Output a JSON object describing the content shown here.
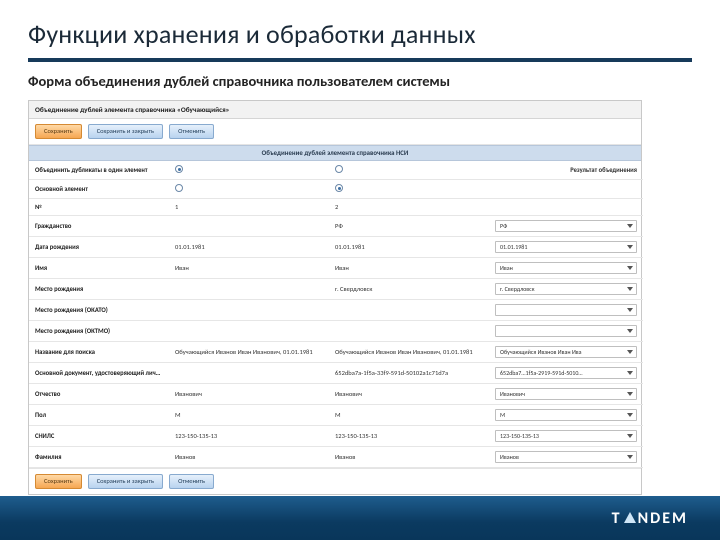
{
  "slide": {
    "title": "Функции хранения и обработки данных",
    "subtitle": "Форма объединения дублей справочника пользователем системы"
  },
  "app": {
    "header": "Объединение дублей элемента справочника «Обучающийся»",
    "band": "Объединение дублей элемента справочника НСИ",
    "buttons": {
      "save": "Сохранить",
      "save_close": "Сохранить и закрыть",
      "cancel": "Отменить"
    },
    "columns": {
      "result_header": "Результат объединения"
    },
    "rows": [
      {
        "label": "Объединить дубликаты в один элемент",
        "c1_radio": true,
        "c2_radio": false,
        "result": null
      },
      {
        "label": "Основной элемент",
        "c1_radio": false,
        "c2_radio": true,
        "result": null
      },
      {
        "label": "№",
        "c1": "1",
        "c2": "2",
        "result": null
      },
      {
        "label": "Гражданство",
        "c1": "",
        "c2": "РФ",
        "result": "РФ"
      },
      {
        "label": "Дата рождения",
        "c1": "01.01.1981",
        "c2": "01.01.1981",
        "result": "01.01.1981"
      },
      {
        "label": "Имя",
        "c1": "Иван",
        "c2": "Иван",
        "result": "Иван"
      },
      {
        "label": "Место рождения",
        "c1": "",
        "c2": "г. Свердловск",
        "result": "г. Свердловск"
      },
      {
        "label": "Место рождения (ОКАТО)",
        "c1": "",
        "c2": "",
        "result": ""
      },
      {
        "label": "Место рождения (ОКТМО)",
        "c1": "",
        "c2": "",
        "result": ""
      },
      {
        "label": "Название для поиска",
        "c1": "Обучающийся Иванов Иван Иванович, 01.01.1981",
        "c2": "Обучающийся Иванов Иван Иванович, 01.01.1981",
        "result": "Обучающийся Иванов Иван Ива"
      },
      {
        "label": "Основной документ, удостоверяющий личность",
        "c1": "",
        "c2": "652dba7a-1f5a-33f9-591d-50102a1c71d7a",
        "result": "652dba7…1f5a-2919-591d-5010…"
      },
      {
        "label": "Отчество",
        "c1": "Иванович",
        "c2": "Иванович",
        "result": "Иванович"
      },
      {
        "label": "Пол",
        "c1": "М",
        "c2": "М",
        "result": "М"
      },
      {
        "label": "СНИЛС",
        "c1": "123-150-135-13",
        "c2": "123-150-135-13",
        "result": "123-150-135-13"
      },
      {
        "label": "Фамилия",
        "c1": "Иванов",
        "c2": "Иванов",
        "result": "Иванов"
      }
    ]
  },
  "footer": {
    "brand_left": "T",
    "brand_right": "NDEM"
  }
}
